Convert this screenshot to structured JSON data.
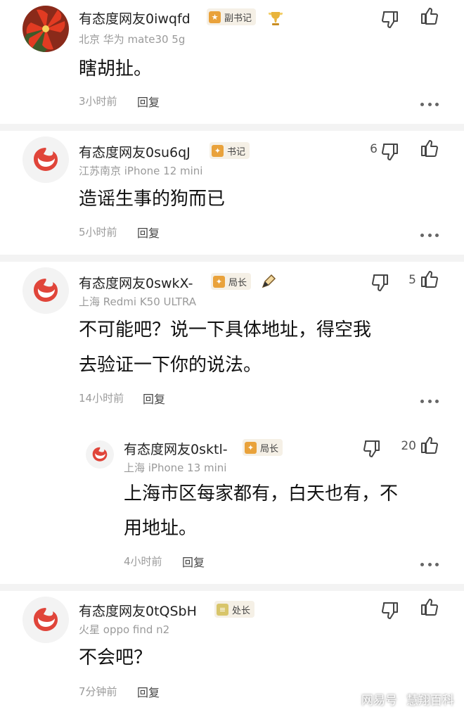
{
  "comments": [
    {
      "username": "有态度网友0iwqfd",
      "badge": "副书记",
      "meta": "北京 华为 mate30 5g",
      "text": "瞎胡扯。",
      "time": "3小时前",
      "reply": "回复",
      "down_count": "",
      "up_count": ""
    },
    {
      "username": "有态度网友0su6qJ",
      "badge": "书记",
      "meta": "江苏南京 iPhone 12 mini",
      "text": "造谣生事的狗而已",
      "time": "5小时前",
      "reply": "回复",
      "down_count": "6",
      "up_count": ""
    },
    {
      "username": "有态度网友0swkX-",
      "badge": "局长",
      "meta": "上海 Redmi K50 ULTRA",
      "text_line1": "不可能吧？说一下具体地址，得空我",
      "text_line2": "去验证一下你的说法。",
      "time": "14小时前",
      "reply": "回复",
      "down_count": "",
      "up_count": "5"
    },
    {
      "username": "有态度网友0sktl-",
      "badge": "局长",
      "meta": "上海 iPhone 13 mini",
      "text_line1": "上海市区每家都有，白天也有，不",
      "text_line2": "用地址。",
      "time": "4小时前",
      "reply": "回复",
      "down_count": "",
      "up_count": "20"
    },
    {
      "username": "有态度网友0tQSbH",
      "badge": "处长",
      "meta": "火星 oppo find n2",
      "text": "不会吧？",
      "time": "7分钟前",
      "reply": "回复",
      "down_count": "",
      "up_count": ""
    }
  ],
  "watermark": {
    "left": "网易号",
    "right": "慧翔百科"
  },
  "colors": {
    "badge_bg": "#f5f0e6",
    "badge_gold": "#e9a23b",
    "logo_red": "#e0453a"
  }
}
